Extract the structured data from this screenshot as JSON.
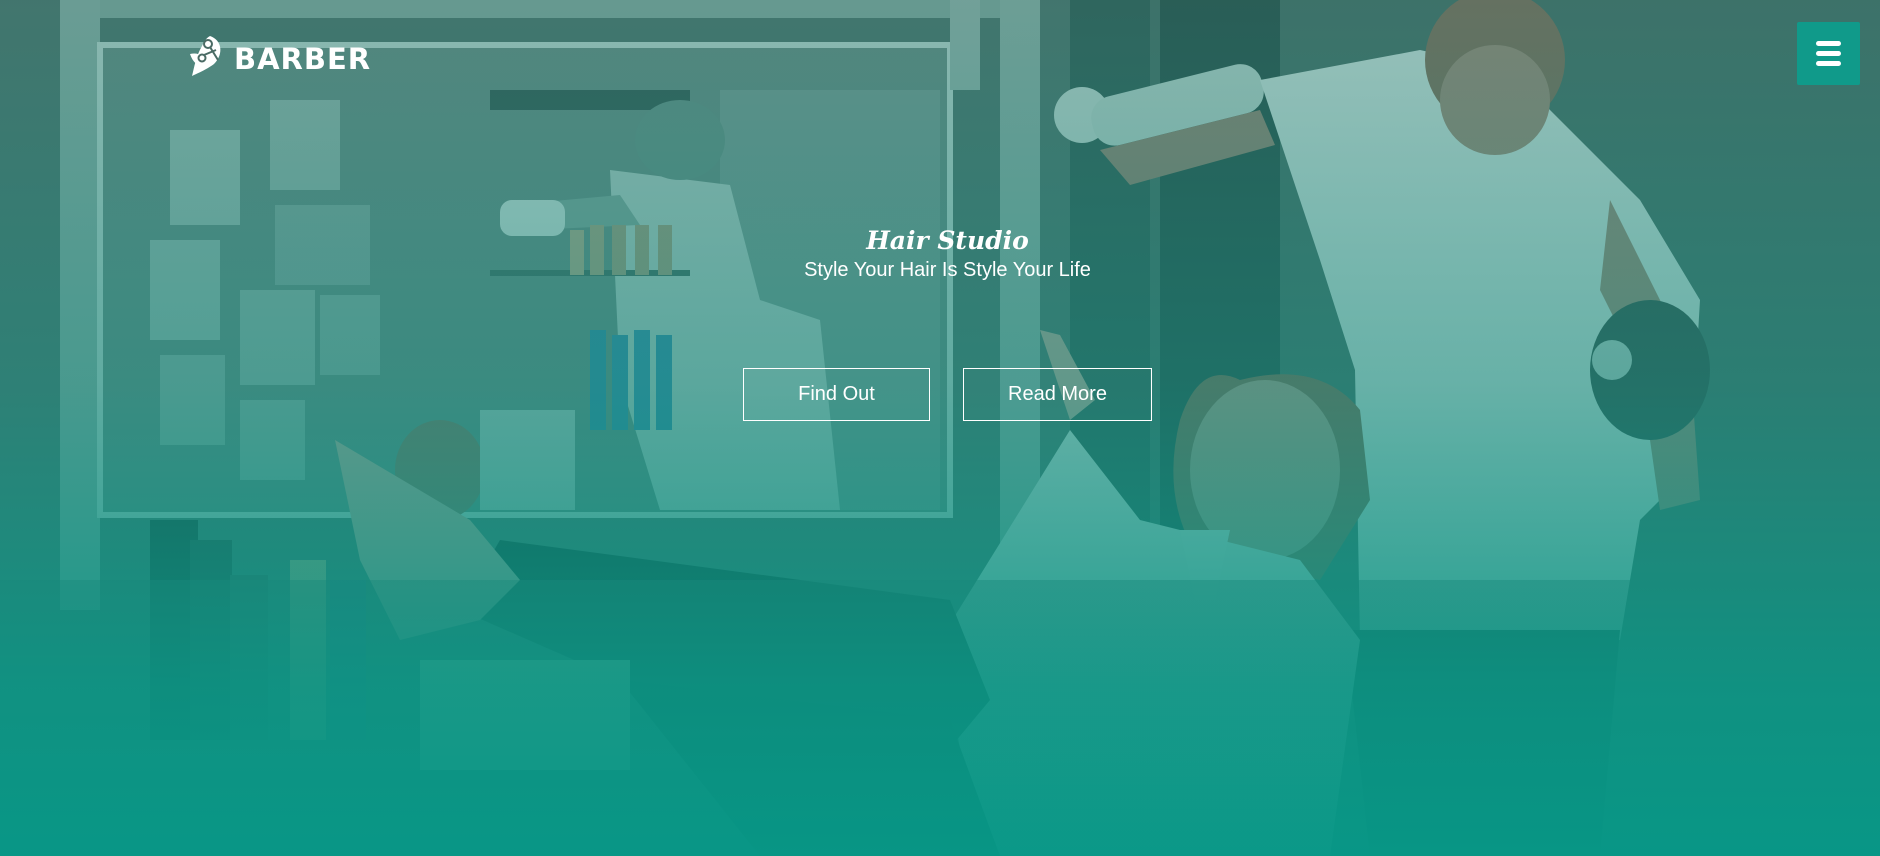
{
  "brand": {
    "name": "BARBER",
    "icon": "scissors-leaf-logo-icon"
  },
  "menu": {
    "icon": "hamburger-menu-icon"
  },
  "hero": {
    "title": "Hair Studio",
    "subtitle": "Style Your Hair Is Style Your Life",
    "buttons": {
      "find_out": "Find Out",
      "read_more": "Read More"
    }
  },
  "colors": {
    "accent": "#109a8a",
    "overlay": "#069887",
    "text": "#ffffff"
  }
}
